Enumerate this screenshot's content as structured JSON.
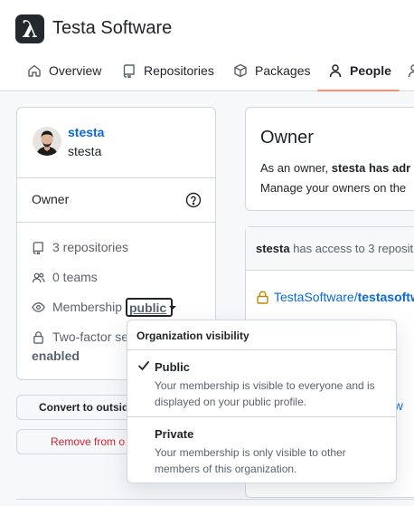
{
  "org": {
    "logo_glyph": "λ",
    "name": "Testa Software"
  },
  "tabs": [
    {
      "label": "Overview",
      "icon": "home-icon"
    },
    {
      "label": "Repositories",
      "icon": "repo-icon"
    },
    {
      "label": "Packages",
      "icon": "package-icon"
    },
    {
      "label": "People",
      "icon": "person-icon",
      "selected": true
    }
  ],
  "member": {
    "login": "stesta",
    "name": "stesta",
    "role": "Owner",
    "repositories": "3 repositories",
    "teams": "0 teams",
    "membership_label": "Membership",
    "membership_value": "public",
    "two_factor_label": "Two-factor se",
    "two_factor_status": "enabled"
  },
  "actions": {
    "convert_label": "Convert to outside",
    "remove_label": "Remove from o"
  },
  "owner_panel": {
    "title": "Owner",
    "line1_prefix": "As an owner, ",
    "line1_user": "stesta",
    "line1_suffix": " has adr",
    "line2": "Manage your owners on the"
  },
  "access": {
    "header_user": "stesta",
    "header_text": " has access to 3 reposit",
    "repo_org": "TestaSoftware/",
    "repo_name": "testasoftw",
    "repo_partial": "ftw"
  },
  "visibility_menu": {
    "title": "Organization visibility",
    "options": [
      {
        "label": "Public",
        "description": "Your membership is visible to everyone and is displayed on your public profile.",
        "selected": true
      },
      {
        "label": "Private",
        "description": "Your membership is only visible to other members of this organization.",
        "selected": false
      }
    ]
  },
  "colors": {
    "accent": "#0969da",
    "tab_underline": "#fd8c73",
    "danger": "#cf222e",
    "border": "#d0d7de"
  }
}
